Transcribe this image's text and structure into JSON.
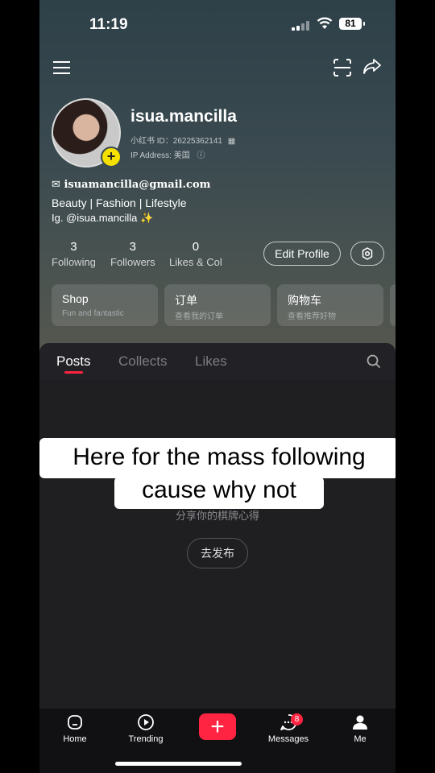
{
  "status": {
    "time": "11:19",
    "battery": "81"
  },
  "profile": {
    "username": "isua.mancilla",
    "id_line": "小红书 ID：26225362141",
    "ip_line": "IP Address: 美国",
    "email": "isuamancilla@gmail.com",
    "bio_line1": "Beauty | Fashion | Lifestyle",
    "bio_line2": "Ig. @isua.mancilla ✨"
  },
  "stats": [
    {
      "num": "3",
      "label": "Following"
    },
    {
      "num": "3",
      "label": "Followers"
    },
    {
      "num": "0",
      "label": "Likes & Col"
    }
  ],
  "edit_profile": "Edit Profile",
  "cards": [
    {
      "title": "Shop",
      "sub": "Fun and fantastic"
    },
    {
      "title": "订单",
      "sub": "查看我的订单"
    },
    {
      "title": "购物车",
      "sub": "查看推荐好物"
    }
  ],
  "tabs": [
    "Posts",
    "Collects",
    "Likes"
  ],
  "empty": {
    "text": "分享你的棋牌心得",
    "button": "去发布"
  },
  "caption": {
    "line1": "Here for the mass following",
    "line2": "cause why not"
  },
  "nav": {
    "home": "Home",
    "trending": "Trending",
    "messages": "Messages",
    "messages_badge": "8",
    "me": "Me"
  },
  "colors": {
    "accent": "#ff2442",
    "avatar_plus": "#f5e000"
  }
}
